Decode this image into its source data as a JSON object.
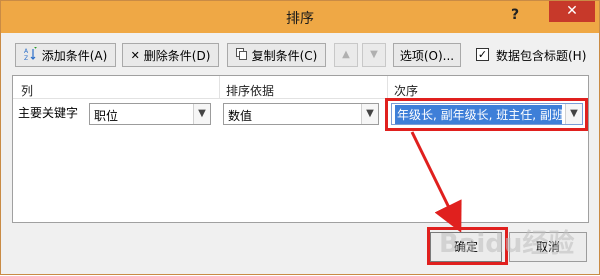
{
  "window": {
    "title": "排序",
    "help_symbol": "?",
    "close_symbol": "✕"
  },
  "toolbar": {
    "add_label": "添加条件(A)",
    "delete_label": "删除条件(D)",
    "copy_label": "复制条件(C)",
    "up_symbol": "▲",
    "down_symbol": "▼",
    "options_label": "选项(O)...",
    "header_checkbox_label": "数据包含标题(H)",
    "header_checkbox_checked": true
  },
  "grid": {
    "headers": [
      "列",
      "排序依据",
      "次序"
    ],
    "rows": [
      {
        "label": "主要关键字",
        "column": "职位",
        "sort_on": "数值",
        "order": "年级长, 副年级长, 班主任, 副班主"
      }
    ]
  },
  "footer": {
    "ok_label": "确定",
    "cancel_label": "取消"
  },
  "watermark": "Baidu经验",
  "colors": {
    "title_bar": "#efa845",
    "close_button": "#c7392a",
    "highlight": "#3e7fd8",
    "annotation": "#e0201e"
  }
}
